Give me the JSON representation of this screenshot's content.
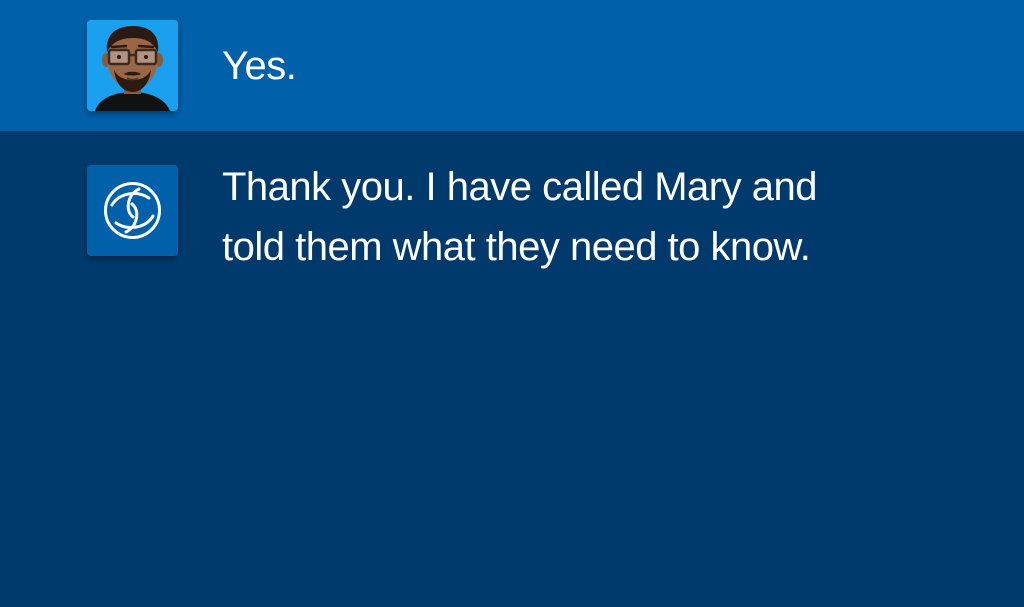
{
  "conversation": {
    "messages": [
      {
        "sender": "user",
        "avatar_icon": "user-avatar-icon",
        "text": "Yes."
      },
      {
        "sender": "assistant",
        "avatar_icon": "assistant-logo-icon",
        "lines": [
          "Thank you. I have called Mary and",
          "told them what they need to know."
        ]
      }
    ]
  },
  "colors": {
    "user_row_background": "#0060a9",
    "assistant_row_background": "#003a6d",
    "user_avatar_background": "#1aa0ee",
    "assistant_avatar_background": "#0060a9",
    "text": "#ffffff"
  }
}
